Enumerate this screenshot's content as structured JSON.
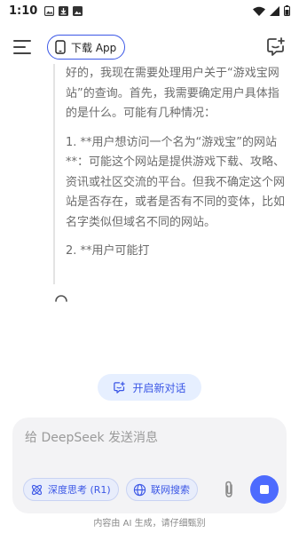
{
  "status_bar": {
    "time": "1:10",
    "icons": [
      "image-icon",
      "download-icon",
      "gallery-icon",
      "wifi-icon",
      "signal-icon",
      "battery-icon"
    ]
  },
  "header": {
    "download_label": "下载 App",
    "icons": [
      "menu-icon",
      "phone-icon",
      "new-chat-icon"
    ]
  },
  "thinking": {
    "paragraphs": [
      "好的，我现在需要处理用户关于“游戏宝网站”的查询。首先，我需要确定用户具体指的是什么。可能有几种情况：",
      "1. **用户想访问一个名为“游戏宝”的网站**：可能这个网站是提供游戏下载、攻略、资讯或社区交流的平台。但我不确定这个网站是否存在，或者是否有不同的变体，比如名字类似但域名不同的网站。",
      "2. **用户可能打"
    ]
  },
  "new_conversation": {
    "label": "开启新对话"
  },
  "composer": {
    "placeholder": "给 DeepSeek 发送消息",
    "value": "",
    "deep_think_label": "深度思考 (R1)",
    "web_search_label": "联网搜索"
  },
  "footer": {
    "note": "内容由 AI 生成，请仔细甄别"
  },
  "colors": {
    "accent": "#4d6bfe",
    "accent_text": "#3b57e6",
    "chip_bg": "#e8edfb",
    "pill_bg": "#e6efff",
    "composer_bg": "#f3f3f5",
    "thinking_text": "#6b6b6b"
  }
}
